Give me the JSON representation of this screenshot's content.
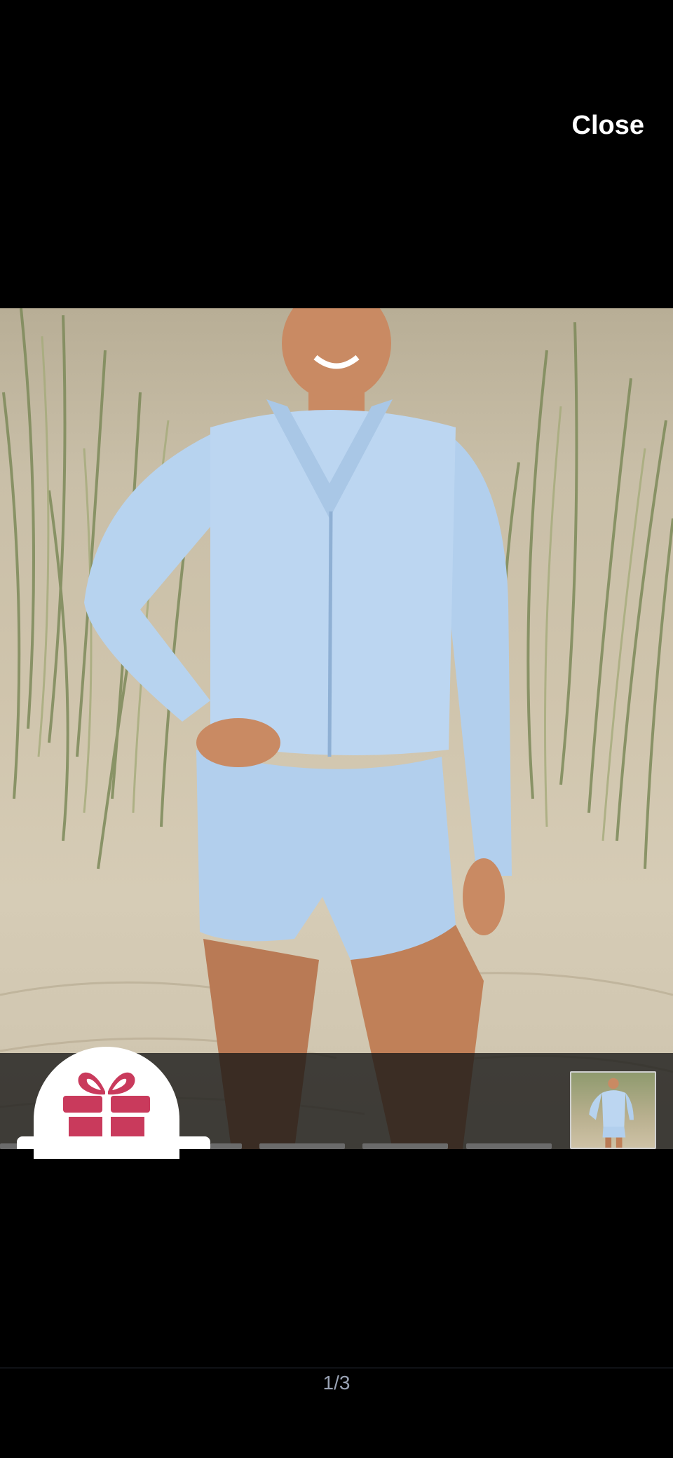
{
  "header": {
    "close_label": "Close"
  },
  "photo": {
    "subject": "product-photo",
    "outfit_color": "#b7d3ef"
  },
  "gallery": {
    "current_page": "1/3",
    "thumbnails_count_visible": 6
  },
  "promo": {
    "icon": "gift-icon",
    "icon_color": "#c93a5c"
  },
  "colors": {
    "background": "#000000",
    "strip_overlay": "#161616",
    "indicator_text": "#9aa3b5"
  }
}
